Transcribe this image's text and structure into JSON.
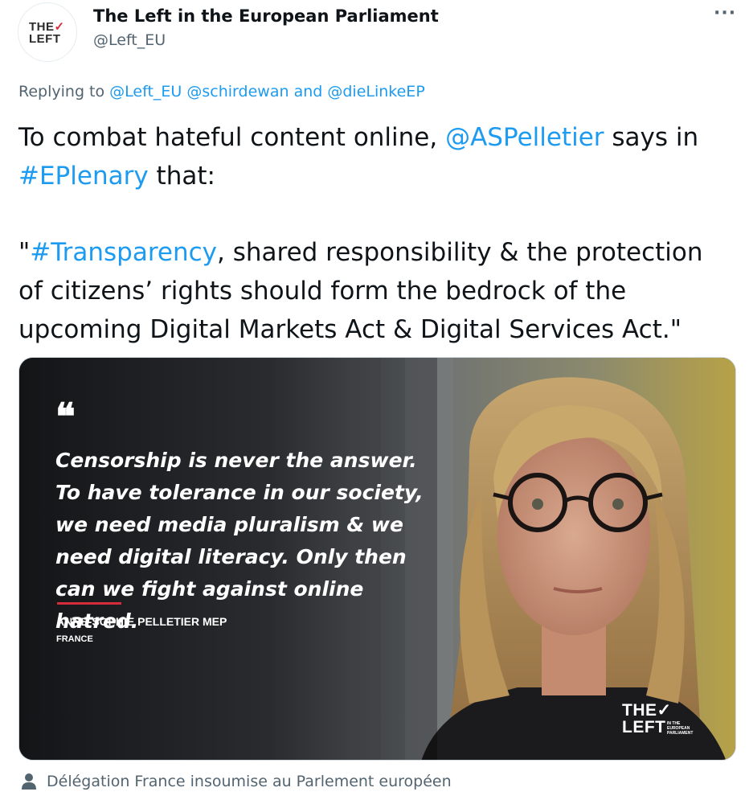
{
  "author": {
    "display_name": "The Left in the European Parliament",
    "handle": "@Left_EU",
    "avatar_logo": {
      "line1": "THE",
      "line2": "LEFT"
    }
  },
  "more_icon": "more-options-icon",
  "reply": {
    "prefix": "Replying to",
    "mentions": [
      "@Left_EU",
      "@schirdewan",
      "and",
      "@dieLinkeEP"
    ]
  },
  "tweet": {
    "p1_a": "To combat hateful content online, ",
    "p1_mention": "@ASPelletier",
    "p1_b": " says in ",
    "p1_hashtag": "#EPlenary",
    "p1_c": " that:",
    "p2_open": "\"",
    "p2_hashtag": "#Transparency",
    "p2_rest": ", shared responsibility & the protection of citizens’ rights should form the bedrock of the upcoming Digital Markets Act & Digital Services Act.\""
  },
  "media": {
    "quote_mark": "66",
    "quote_text": "Censorship is never the answer. To have tolerance in our society, we need media pluralism & we need digital literacy. Only then can we fight against online hatred.",
    "speaker": "ANNE-SOPHIE PELLETIER MEP",
    "country": "FRANCE",
    "logo_line1": "THE",
    "logo_line2": "LEFT",
    "logo_sub": "IN THE EUROPEAN PARLIAMENT"
  },
  "credit": {
    "icon": "person-icon",
    "text": "Délégation France insoumise au Parlement européen"
  },
  "colors": {
    "link": "#1d9bf0",
    "muted": "#536471",
    "accent_red": "#d62b3b"
  }
}
